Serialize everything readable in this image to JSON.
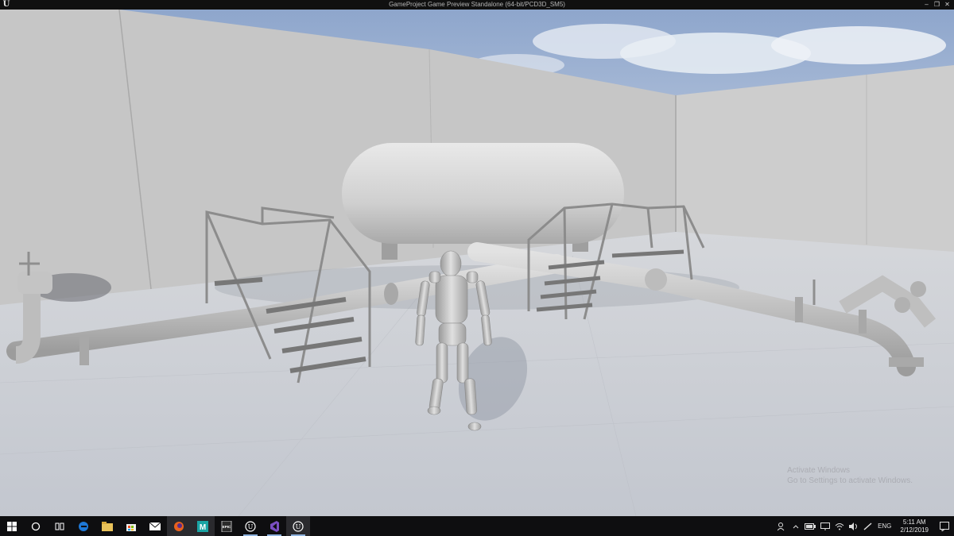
{
  "window": {
    "title": "GameProject Game Preview Standalone (64-bit/PCD3D_SM5)",
    "logo": "U",
    "controls": {
      "minimize": "–",
      "maximize": "❐",
      "close": "✕"
    }
  },
  "watermark": {
    "line1": "Activate Windows",
    "line2": "Go to Settings to activate Windows."
  },
  "taskbar": {
    "apps": [
      {
        "name": "windows-start",
        "icon": "windows-logo-icon"
      },
      {
        "name": "cortana-search",
        "icon": "circle-icon"
      },
      {
        "name": "task-view",
        "icon": "task-view-icon"
      },
      {
        "name": "edge",
        "icon": "edge-icon"
      },
      {
        "name": "file-explorer",
        "icon": "folder-icon"
      },
      {
        "name": "store",
        "icon": "store-bag-icon"
      },
      {
        "name": "mail",
        "icon": "mail-icon"
      },
      {
        "name": "firefox",
        "icon": "firefox-icon"
      },
      {
        "name": "maya",
        "icon": "maya-icon",
        "label": "M"
      },
      {
        "name": "epic-launcher",
        "icon": "epic-icon",
        "label": "EPIC"
      },
      {
        "name": "unreal-editor",
        "icon": "unreal-icon"
      },
      {
        "name": "visual-studio",
        "icon": "visual-studio-icon"
      },
      {
        "name": "unreal-game",
        "icon": "unreal-icon"
      }
    ],
    "tray": {
      "language": "ENG",
      "time": "5:11 AM",
      "date": "2/12/2019"
    }
  },
  "colors": {
    "titlebar": "#101010",
    "taskbar": "#0e0e10",
    "sky": "#9fb2d1",
    "wall": "#c8c8c8",
    "floor": "#c9ccd2",
    "edge_blue": "#1e78d6",
    "firefox_orange": "#e8621d",
    "maya_teal": "#1aa4a4",
    "vs_purple": "#7a4fc1"
  }
}
